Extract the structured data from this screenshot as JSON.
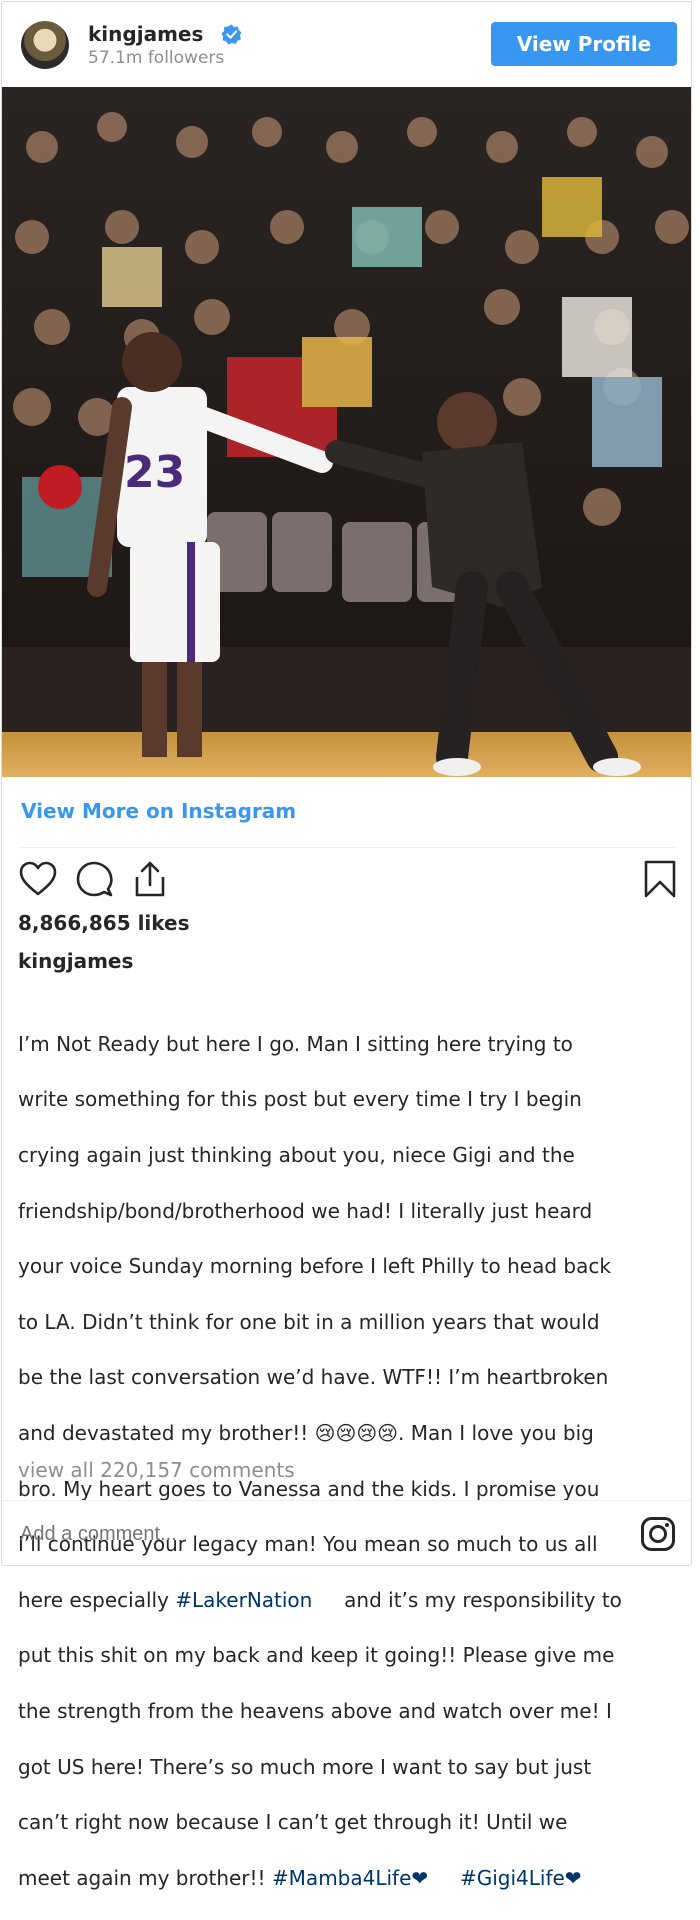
{
  "header": {
    "username": "kingjames",
    "verified_icon": "verified-badge-icon",
    "followers": "57.1m followers",
    "view_profile_label": "View Profile"
  },
  "post": {
    "image_icon": "post-photo",
    "view_more_label": "View More on Instagram",
    "likes": "8,866,865 likes",
    "caption_user": "kingjames",
    "caption_lines": [
      "I’m Not Ready but here I go. Man I sitting here trying to",
      "write something for this post but every time I try I begin",
      "crying again just thinking about you, niece Gigi and the",
      "friendship/bond/brotherhood we had! I literally just heard",
      "your voice Sunday morning before I left Philly to head back",
      "to LA. Didn’t think for one bit in a million years that would",
      "be the last conversation we’d have. WTF!! I’m heartbroken",
      "and devastated my brother!! 😢😢😢😢. Man I love you big",
      "bro. My heart goes to Vanessa and the kids. I promise you",
      "I’ll continue your legacy man! You mean so much to us all"
    ],
    "caption_line_11_prefix": "here especially ",
    "hashtag_1": "#LakerNation",
    "caption_line_11_suffix": "     and it’s my responsibility to",
    "caption_lines_after": [
      "put this shit on my back and keep it going!! Please give me",
      "the strength from the heavens above and watch over me! I",
      "got US here! There’s so much more I want to say but just",
      "can’t right now because I can’t get through it! Until we"
    ],
    "caption_last_prefix": "meet again my brother!! ",
    "hashtag_2": "#Mamba4Life❤",
    "hashtag_3": "#Gigi4Life❤",
    "comments_link": "view all 220,157 comments",
    "comment_placeholder": "Add a comment..."
  },
  "icons": {
    "like": "heart-icon",
    "comment": "comment-icon",
    "share": "share-icon",
    "save": "bookmark-icon",
    "instagram": "instagram-icon"
  },
  "colors": {
    "accent": "#3897f0",
    "hashtag": "#003569",
    "muted": "#8e8e8e"
  }
}
